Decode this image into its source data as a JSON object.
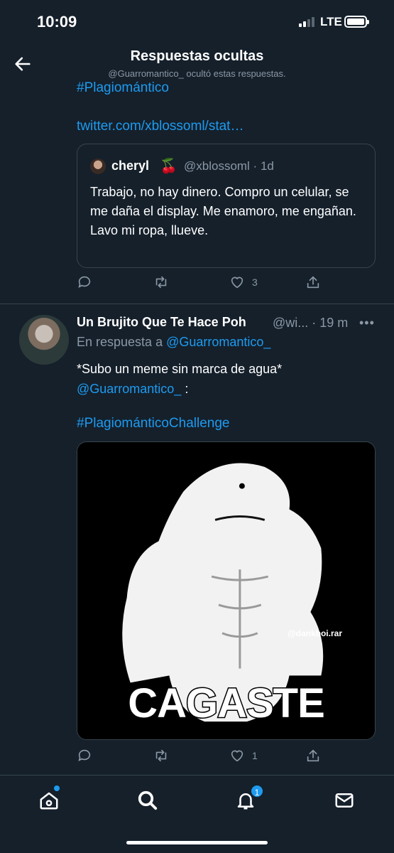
{
  "status_bar": {
    "time": "10:09",
    "network": "LTE"
  },
  "header": {
    "title": "Respuestas ocultas",
    "subtitle": "@Guarromantico_ ocultó estas respuestas."
  },
  "tweet1": {
    "hashtag": "#Plagiomántico",
    "url": "twitter.com/xblossoml/stat…",
    "quote": {
      "name": "cheryl",
      "emoji": "🍒",
      "handle_time": "@xblossoml · 1d",
      "text": "Trabajo, no hay dinero.  Compro un celular, se me daña el display. Me enamoro, me engañan. Lavo mi ropa, llueve."
    },
    "likes": "3"
  },
  "tweet2": {
    "name": "Un Brujito Que Te Hace Poh",
    "handle_time": "@wi... · 19 m",
    "more": "•••",
    "reply_prefix": "En respuesta a ",
    "reply_handle": "@Guarromantico_",
    "text_line1": "*Subo un meme sin marca de agua*",
    "text_mention": "@Guarromantico_",
    "text_suffix": " :",
    "hashtag": "#PlagiománticoChallenge",
    "media": {
      "watermark": "@dankboi.rar",
      "caption": "CAGASTE"
    },
    "likes": "1"
  },
  "bottom_nav": {
    "notifications_badge": "1"
  },
  "colors": {
    "background": "#15202b",
    "accent": "#1d9bf0",
    "muted": "#8b98a5",
    "border": "#38444d"
  }
}
